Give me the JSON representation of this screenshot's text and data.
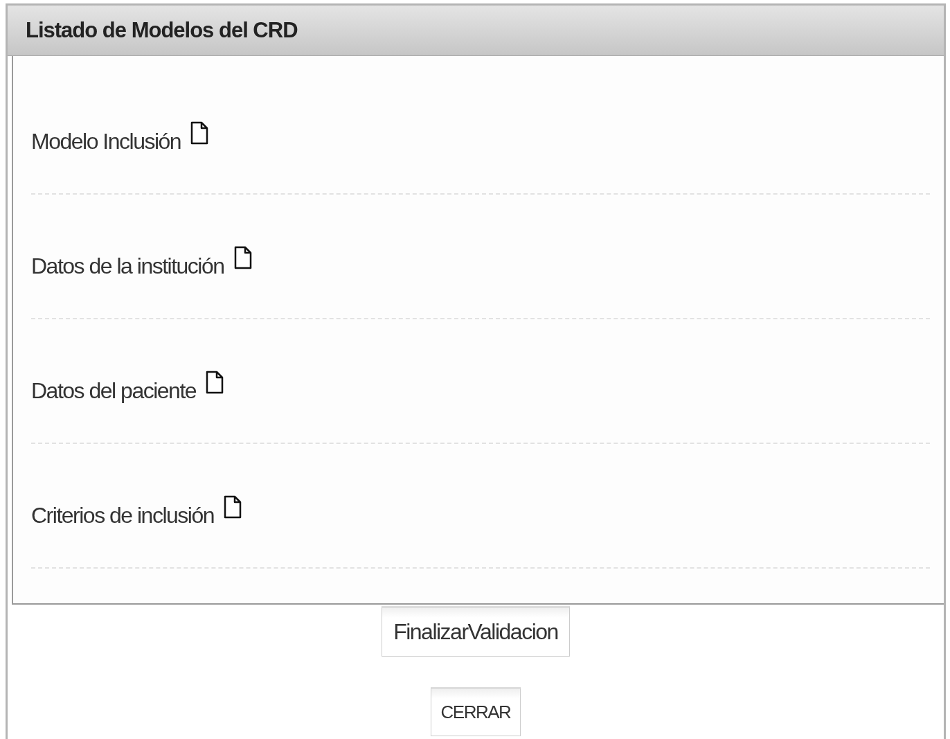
{
  "panel": {
    "title": "Listado de Modelos del CRD"
  },
  "models": [
    {
      "label": "Modelo Inclusión"
    },
    {
      "label": "Datos de la institución"
    },
    {
      "label": "Datos del paciente"
    },
    {
      "label": "Criterios de inclusión"
    }
  ],
  "buttons": [
    {
      "label": "FinalizarValidacion"
    },
    {
      "label": "CERRAR"
    }
  ]
}
